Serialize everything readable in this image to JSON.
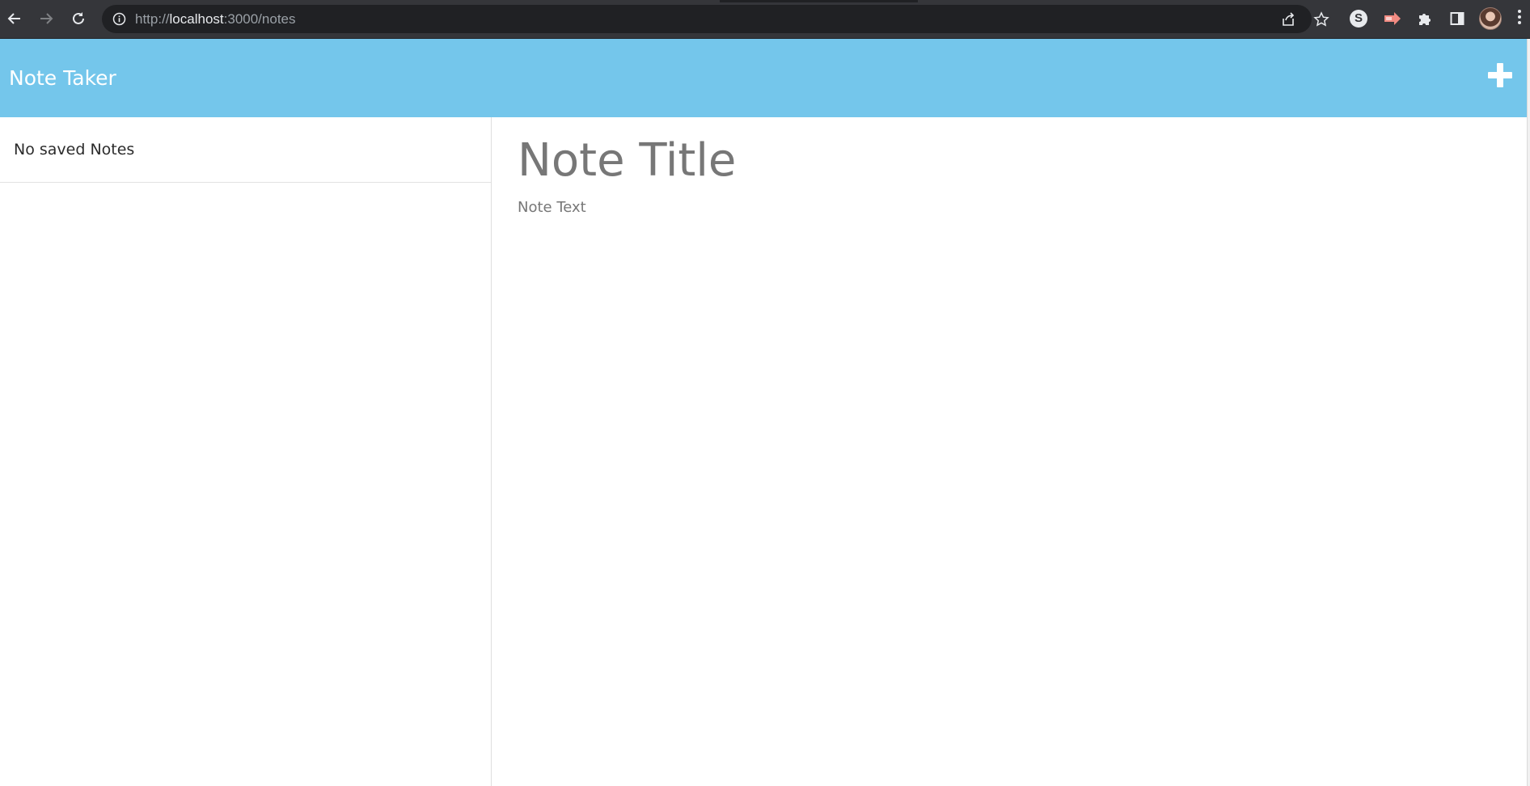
{
  "browser": {
    "url_scheme": "http://",
    "url_host": "localhost",
    "url_rest": ":3000/notes",
    "extensions": [
      "s-extension-icon",
      "arrow-extension-icon",
      "puzzle-icon",
      "side-panel-icon"
    ],
    "accent_extension_color": "#f28b82"
  },
  "app": {
    "title": "Note Taker",
    "header_color": "#74c6eb",
    "add_icon": "plus-icon"
  },
  "sidebar": {
    "empty_message": "No saved Notes"
  },
  "editor": {
    "title_placeholder": "Note Title",
    "text_placeholder": "Note Text"
  }
}
